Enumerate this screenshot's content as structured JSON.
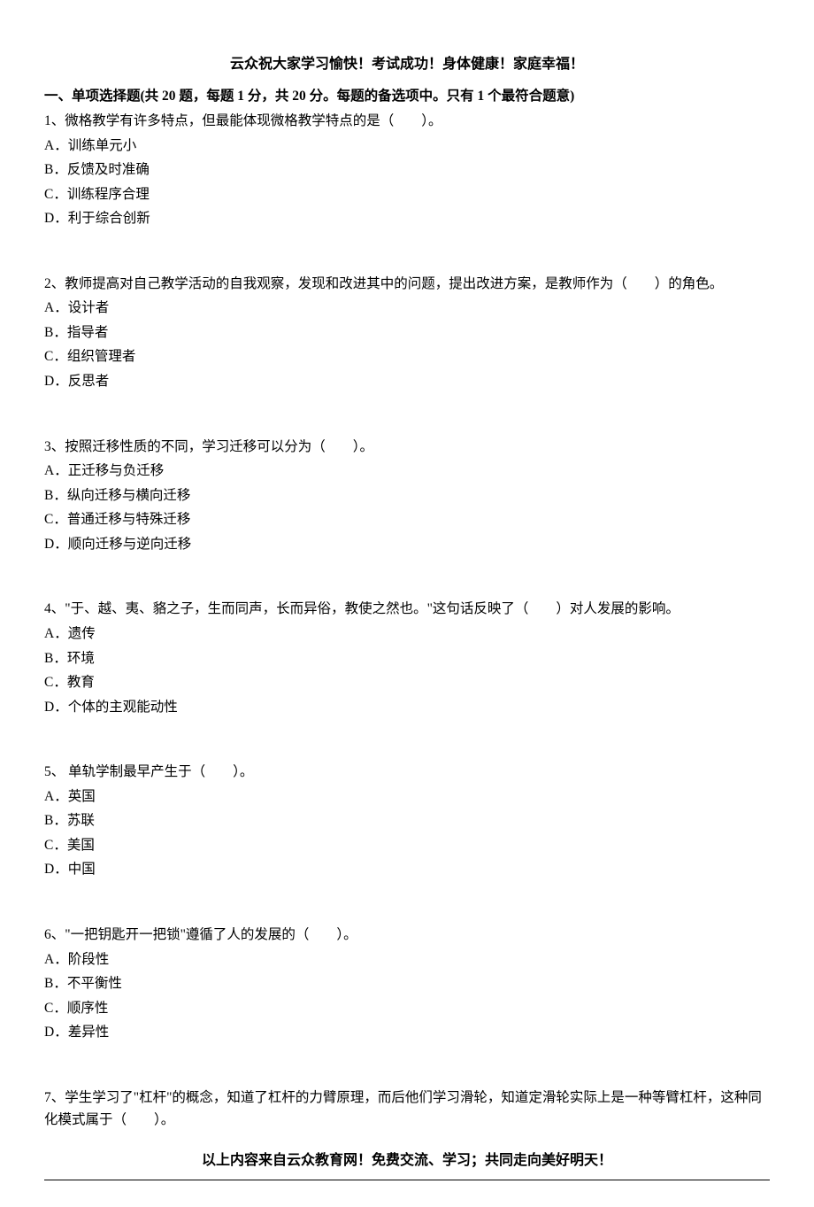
{
  "header": {
    "title": "云众祝大家学习愉快！考试成功！身体健康！家庭幸福！"
  },
  "section": {
    "title": "一、单项选择题(共 20 题，每题 1 分，共 20 分。每题的备选项中。只有 1 个最符合题意)"
  },
  "questions": [
    {
      "stem": "1、微格教学有许多特点，但最能体现微格教学特点的是（　　）。",
      "options": [
        "A．训练单元小",
        "B．反馈及时准确",
        "C．训练程序合理",
        "D．利于综合创新"
      ]
    },
    {
      "stem": "2、教师提高对自己教学活动的自我观察，发现和改进其中的问题，提出改进方案，是教师作为（　　）的角色。",
      "options": [
        "A．设计者",
        "B．指导者",
        "C．组织管理者",
        "D．反思者"
      ]
    },
    {
      "stem": "3、按照迁移性质的不同，学习迁移可以分为（　　）。",
      "options": [
        "A．正迁移与负迁移",
        "B．纵向迁移与横向迁移",
        "C．普通迁移与特殊迁移",
        "D．顺向迁移与逆向迁移"
      ]
    },
    {
      "stem": "4、\"于、越、夷、貉之子，生而同声，长而异俗，教使之然也。\"这句话反映了（　　）对人发展的影响。",
      "options": [
        "A．遗传",
        "B．环境",
        "C．教育",
        "D．个体的主观能动性"
      ]
    },
    {
      "stem": "5、  单轨学制最早产生于（　　）。",
      "options": [
        "A．英国",
        "B．苏联",
        "C．美国",
        "D．中国"
      ]
    },
    {
      "stem": "6、\"一把钥匙开一把锁\"遵循了人的发展的（　　）。",
      "options": [
        "A．阶段性",
        "B．不平衡性",
        "C．顺序性",
        "D．差异性"
      ]
    },
    {
      "stem": "7、学生学习了\"杠杆\"的概念，知道了杠杆的力臂原理，而后他们学习滑轮，知道定滑轮实际上是一种等臂杠杆，这种同化模式属于（　　）。",
      "options": []
    }
  ],
  "footer": {
    "note": "以上内容来自云众教育网！免费交流、学习；共同走向美好明天！"
  }
}
